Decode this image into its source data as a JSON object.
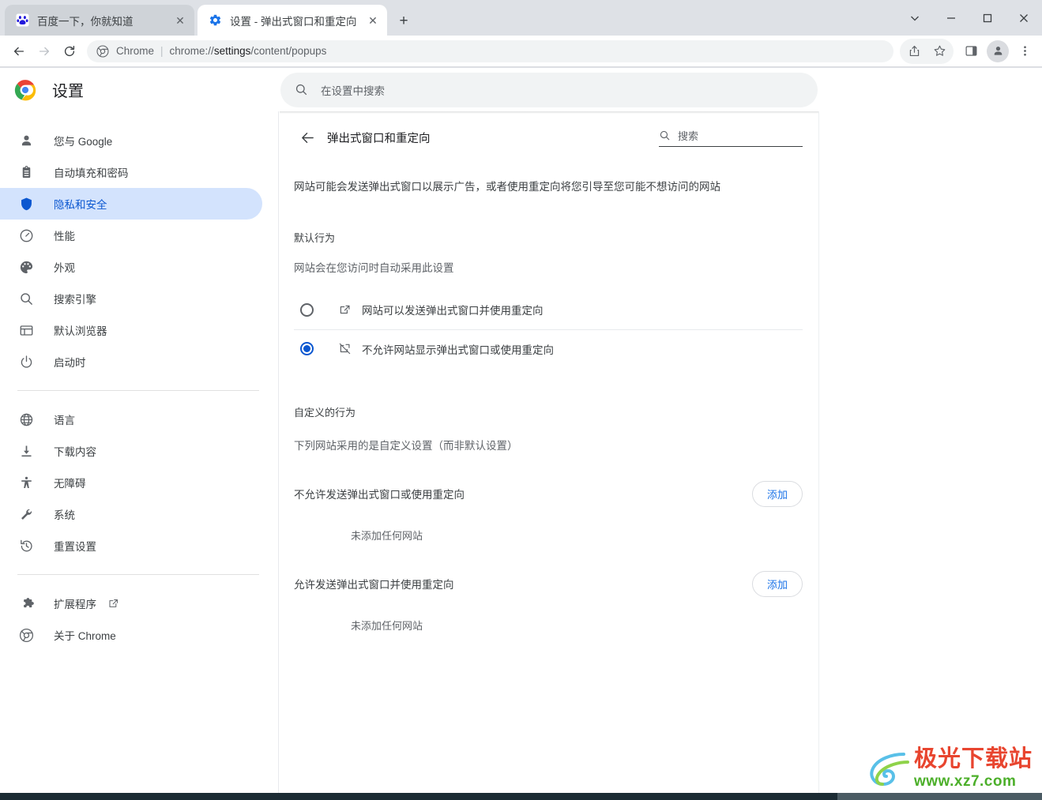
{
  "window": {
    "controls": [
      {
        "name": "chevron-down-icon",
        "label": "⌄"
      },
      {
        "name": "minimize-icon",
        "label": "–"
      },
      {
        "name": "maximize-icon",
        "label": "□"
      },
      {
        "name": "close-icon",
        "label": "✕"
      }
    ]
  },
  "tabs": [
    {
      "title": "百度一下，你就知道",
      "favicon": "baidu-icon",
      "active": false,
      "close_label": "✕"
    },
    {
      "title": "设置 - 弹出式窗口和重定向",
      "favicon": "gear-icon",
      "active": true,
      "close_label": "✕"
    }
  ],
  "new_tab_label": "+",
  "toolbar": {
    "back_icon": "back-arrow-icon",
    "forward_icon": "forward-arrow-icon",
    "reload_icon": "reload-icon",
    "omnibox": {
      "site_icon": "chrome-icon",
      "scheme_label": "Chrome",
      "separator": "|",
      "url_scheme": "chrome://",
      "url_strong": "settings",
      "url_rest": "/content/popups",
      "full_url": "chrome://settings/content/popups"
    },
    "share_icon": "share-icon",
    "bookmark_icon": "star-icon",
    "side_panel_icon": "side-panel-icon",
    "profile_icon": "avatar-icon",
    "menu_icon": "three-dot-menu-icon"
  },
  "settings_header": {
    "logo": "chrome-logo-icon",
    "title": "设置",
    "search": {
      "icon": "search-icon",
      "placeholder": "在设置中搜索"
    }
  },
  "sidebar": {
    "items": [
      {
        "label": "您与 Google",
        "icon": "person-icon",
        "selected": false
      },
      {
        "label": "自动填充和密码",
        "icon": "clipboard-icon",
        "selected": false
      },
      {
        "label": "隐私和安全",
        "icon": "shield-icon",
        "selected": true
      },
      {
        "label": "性能",
        "icon": "speedometer-icon",
        "selected": false
      },
      {
        "label": "外观",
        "icon": "palette-icon",
        "selected": false
      },
      {
        "label": "搜索引擎",
        "icon": "search-icon",
        "selected": false
      },
      {
        "label": "默认浏览器",
        "icon": "browser-window-icon",
        "selected": false
      },
      {
        "label": "启动时",
        "icon": "power-icon",
        "selected": false
      }
    ],
    "items2": [
      {
        "label": "语言",
        "icon": "globe-icon",
        "selected": false
      },
      {
        "label": "下载内容",
        "icon": "download-icon",
        "selected": false
      },
      {
        "label": "无障碍",
        "icon": "accessibility-icon",
        "selected": false
      },
      {
        "label": "系统",
        "icon": "wrench-icon",
        "selected": false
      },
      {
        "label": "重置设置",
        "icon": "restore-icon",
        "selected": false
      }
    ],
    "items3": [
      {
        "label": "扩展程序",
        "icon": "puzzle-icon",
        "external": true,
        "external_icon": "open-in-new-icon",
        "selected": false
      },
      {
        "label": "关于 Chrome",
        "icon": "chrome-circle-icon",
        "external": false,
        "selected": false
      }
    ]
  },
  "main": {
    "back_icon": "back-arrow-icon",
    "page_title": "弹出式窗口和重定向",
    "search": {
      "icon": "search-icon",
      "placeholder": "搜索"
    },
    "description": "网站可能会发送弹出式窗口以展示广告，或者使用重定向将您引导至您可能不想访问的网站",
    "default_behavior_label": "默认行为",
    "default_behavior_sub": "网站会在您访问时自动采用此设置",
    "radio_options": [
      {
        "label": "网站可以发送弹出式窗口并使用重定向",
        "icon": "open-in-new-icon",
        "checked": false
      },
      {
        "label": "不允许网站显示弹出式窗口或使用重定向",
        "icon": "open-in-new-off-icon",
        "checked": true
      }
    ],
    "custom_behavior_label": "自定义的行为",
    "custom_behavior_sub": "下列网站采用的是自定义设置（而非默认设置）",
    "permission_blocks": [
      {
        "title": "不允许发送弹出式窗口或使用重定向",
        "add_label": "添加",
        "empty_note": "未添加任何网站"
      },
      {
        "title": "允许发送弹出式窗口并使用重定向",
        "add_label": "添加",
        "empty_note": "未添加任何网站"
      }
    ]
  },
  "watermark": {
    "main_text": "极光下载站",
    "sub_text": "www.xz7.com",
    "icon": "swirl-logo-icon"
  },
  "colors": {
    "accent_blue": "#0b57d0",
    "link_blue": "#1a73e8",
    "selected_bg": "#d3e3fd",
    "tabstrip_bg": "#dee1e6",
    "inactive_tab_bg": "#cfd3d8",
    "text_primary": "#202124",
    "text_secondary": "#5f6368",
    "watermark_red": "#e8452f",
    "watermark_green": "#4caf2a",
    "taskbar": "#1b2b33"
  }
}
